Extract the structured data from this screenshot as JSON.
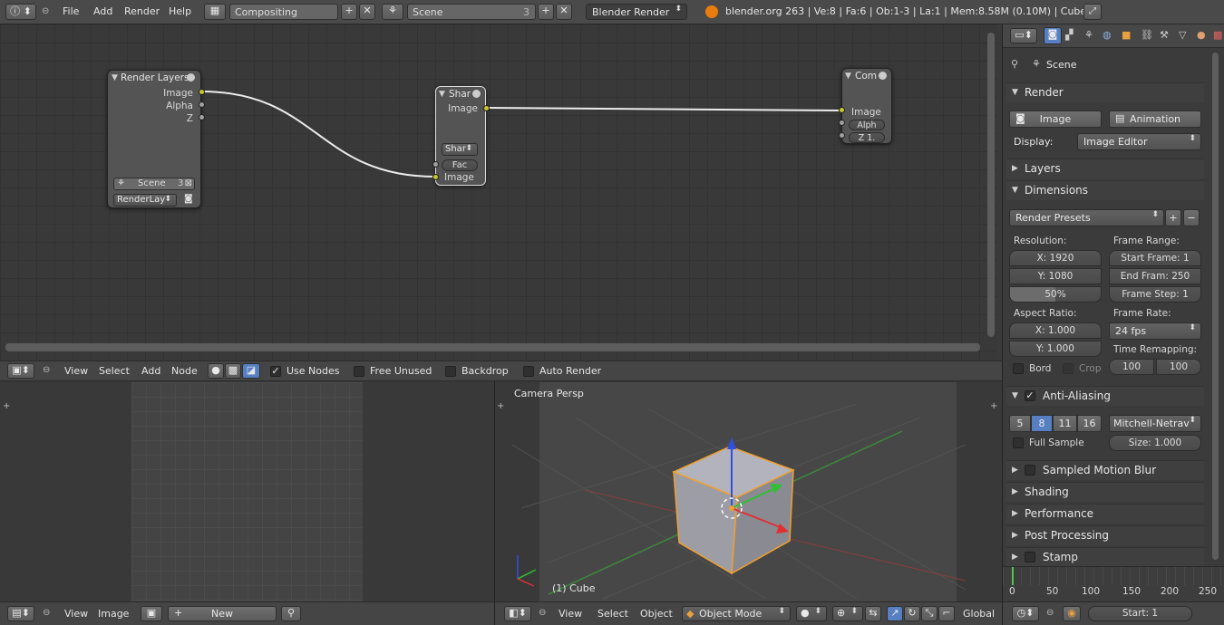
{
  "top_header": {
    "menus": [
      "File",
      "Add",
      "Render",
      "Help"
    ],
    "screen_layout": "Compositing",
    "scene_name": "Scene",
    "scene_users": "3",
    "render_engine": "Blender Render",
    "stats": "blender.org 263 | Ve:8 | Fa:6 | Ob:1-3 | La:1 | Mem:8.58M (0.10M) | Cube"
  },
  "node_editor": {
    "nodes": {
      "render_layers": {
        "title": "Render Layers",
        "outputs": [
          "Image",
          "Alpha",
          "Z"
        ],
        "scene": "Scene",
        "scene_users": "3",
        "layer": "RenderLay"
      },
      "sharpen": {
        "title": "Shar",
        "output": "Image",
        "type_select": "Shar",
        "fac": "Fac",
        "input": "Image"
      },
      "composite": {
        "title": "Com",
        "inputs": [
          "Image",
          "Alph",
          "Z 1."
        ]
      }
    },
    "header": {
      "menus": [
        "View",
        "Select",
        "Add",
        "Node"
      ],
      "checkboxes": [
        {
          "label": "Use Nodes",
          "checked": true
        },
        {
          "label": "Free Unused",
          "checked": false
        },
        {
          "label": "Backdrop",
          "checked": false
        },
        {
          "label": "Auto Render",
          "checked": false
        }
      ]
    }
  },
  "image_editor": {
    "menus": [
      "View",
      "Image"
    ],
    "new_label": "New"
  },
  "viewport": {
    "label": "Camera Persp",
    "object_label": "(1) Cube",
    "menus": [
      "View",
      "Select",
      "Object"
    ],
    "mode": "Object Mode",
    "orientation": "Global"
  },
  "properties": {
    "context_label": "Scene",
    "render_panel": {
      "title": "Render",
      "image_btn": "Image",
      "animation_btn": "Animation",
      "display_label": "Display:",
      "display_value": "Image Editor"
    },
    "layers_title": "Layers",
    "dimensions": {
      "title": "Dimensions",
      "presets": "Render Presets",
      "resolution_label": "Resolution:",
      "res_x": "X: 1920",
      "res_y": "Y: 1080",
      "res_pct": "50%",
      "res_pct_fraction": 0.5,
      "frame_range_label": "Frame Range:",
      "start_frame": "Start Frame: 1",
      "end_frame": "End Fram: 250",
      "frame_step": "Frame Step: 1",
      "aspect_label": "Aspect Ratio:",
      "aspect_x": "X: 1.000",
      "aspect_y": "Y: 1.000",
      "frame_rate_label": "Frame Rate:",
      "frame_rate": "24 fps",
      "time_remap_label": "Time Remapping:",
      "remap_old": "100",
      "remap_new": "100",
      "bord_label": "Bord",
      "crop_label": "Crop"
    },
    "anti_aliasing": {
      "title": "Anti-Aliasing",
      "samples": [
        "5",
        "8",
        "11",
        "16"
      ],
      "selected_sample": "8",
      "filter": "Mitchell-Netrav",
      "full_sample": "Full Sample",
      "size": "Size: 1.000"
    },
    "collapsed_panels": [
      "Sampled Motion Blur",
      "Shading",
      "Performance",
      "Post Processing",
      "Stamp"
    ]
  },
  "timeline": {
    "ticks": [
      "0",
      "50",
      "100",
      "150",
      "200",
      "250"
    ],
    "start": "Start: 1"
  },
  "colors": {
    "accent_blue": "#5680c2",
    "socket_yellow": "#c7c729",
    "selection_orange": "#f0a030"
  }
}
